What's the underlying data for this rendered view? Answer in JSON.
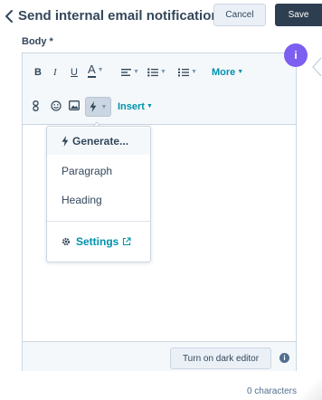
{
  "header": {
    "title": "Send internal email notification",
    "cancel_label": "Cancel",
    "save_label": "Save"
  },
  "field": {
    "label": "Body *"
  },
  "toolbar": {
    "bold": "B",
    "italic": "I",
    "underline": "U",
    "font_color": "A",
    "more_label": "More",
    "insert_label": "Insert",
    "icons": [
      "bold-icon",
      "italic-icon",
      "underline-icon",
      "text-color-icon",
      "align-icon",
      "bullet-list-icon",
      "numbered-list-icon",
      "link-icon",
      "emoji-icon",
      "image-icon",
      "ai-lightning-icon"
    ]
  },
  "menu": {
    "items": [
      {
        "label": "Generate..."
      },
      {
        "label": "Paragraph"
      },
      {
        "label": "Heading"
      }
    ],
    "settings_label": "Settings"
  },
  "info_badge": "i",
  "footer": {
    "dark_editor_label": "Turn on dark editor",
    "char_count": "0 characters"
  },
  "colors": {
    "primary_dark": "#2d3e50",
    "link": "#0091ae",
    "text": "#33475b",
    "accent_purple": "#7c5ef0",
    "toolbar_bg": "#f5f8fa",
    "border": "#cbd6e2"
  }
}
